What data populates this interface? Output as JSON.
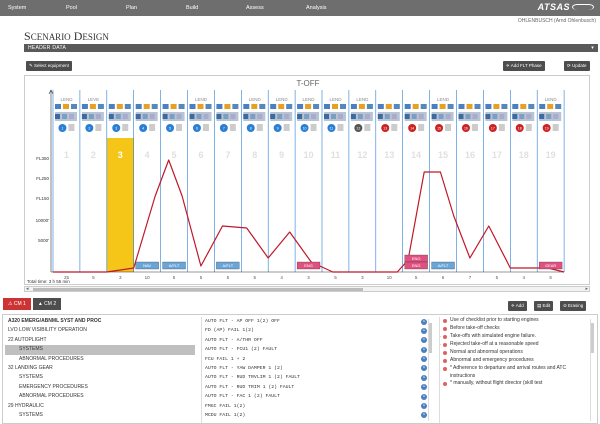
{
  "nav": {
    "menu": [
      "System",
      "Pool",
      "Plan",
      "Build",
      "Assess",
      "Analysis"
    ],
    "logo": "ATSAS"
  },
  "user": "OHLENBUSCH (Arnd Ohlenbusch)",
  "page": {
    "title": "Scenario design",
    "header_bar": "HEADER DATA"
  },
  "toolbar": {
    "select_equipment": "Select equipment",
    "add_flt_phase": "Add FLT Phase",
    "update": "Update"
  },
  "timeline": {
    "title": "T-OFF",
    "phase_labels": [
      "LEND",
      "LEVE",
      "",
      "",
      "",
      "LEND",
      "",
      "LEND",
      "LEND",
      "LEND",
      "LEND",
      "LEND",
      "",
      "",
      "LEND",
      "",
      "",
      "",
      "LEND",
      ""
    ],
    "steps": [
      1,
      2,
      3,
      4,
      5,
      6,
      7,
      8,
      9,
      10,
      11,
      12,
      13,
      14,
      15,
      16,
      17,
      18,
      19
    ],
    "selected_step": 3,
    "y_labels": [
      "FL350",
      "FL250",
      "FL150",
      "10000'",
      "5000'"
    ],
    "bottom_numbers": [
      "25",
      "5",
      "3",
      "10",
      "5",
      "5",
      "5",
      "5",
      "4",
      "3",
      "5",
      "3",
      "10",
      "5",
      "6",
      "7",
      "5",
      "4",
      "5"
    ],
    "bars": [
      {
        "step": 4,
        "label": "NAV"
      },
      {
        "step": 5,
        "label": "A/FLT"
      },
      {
        "step": 7,
        "label": "A/FLT"
      },
      {
        "step": 10,
        "label": "ENG"
      },
      {
        "step": 14,
        "label": "ENG"
      },
      {
        "step": 14,
        "label": "ENG"
      },
      {
        "step": 15,
        "label": "A/FLT"
      },
      {
        "step": 19,
        "label": "GEAR"
      }
    ],
    "total_time": "Total time: 3 h 55 min",
    "icon_colors": [
      "#2a7fd4",
      "#2a7fd4",
      "#2a7fd4",
      "#2a7fd4",
      "#2a7fd4",
      "#2a7fd4",
      "#2a7fd4",
      "#2a7fd4",
      "#2a7fd4",
      "#2a7fd4",
      "#2a7fd4",
      "#555555",
      "#cc2222",
      "#cc2222",
      "#cc2222",
      "#cc2222",
      "#cc2222",
      "#cc2222",
      "#cc2222"
    ],
    "circle_numbers": [
      "1",
      "2",
      "3",
      "4",
      "5",
      "6",
      "7",
      "8",
      "9",
      "10",
      "11",
      "12",
      "13",
      "14",
      "15",
      "16",
      "17",
      "18",
      "19"
    ]
  },
  "bottom": {
    "tabs": [
      "CM 1",
      "CM 2"
    ],
    "buttons": {
      "add": "Add",
      "edit": "Edit",
      "erasing": "Erasing"
    },
    "col_a": [
      {
        "text": "A320 EMERG/ABNML SYST AND PROC",
        "style": "b"
      },
      {
        "text": "LVO LOW VISIBILITY OPERATION",
        "style": ""
      },
      {
        "text": "22 AUTOPLIGHT",
        "style": ""
      },
      {
        "text": "SYSTEMS",
        "style": "ind sel"
      },
      {
        "text": "ABNORMAL PROCEDURES",
        "style": "ind"
      },
      {
        "text": "32 LANDING GEAR",
        "style": ""
      },
      {
        "text": "SYSTEMS",
        "style": "ind"
      },
      {
        "text": "EMERGENCY PROCEDURES",
        "style": "ind"
      },
      {
        "text": "ABNORMAL PROCEDURES",
        "style": "ind"
      },
      {
        "text": "29 HYDRAULIC",
        "style": ""
      },
      {
        "text": "SYSTEMS",
        "style": "ind"
      }
    ],
    "col_b": [
      "AUTO FLT - AP OFF 1(2) OFF",
      "FD (AP) FAIL 1(2)",
      "AUTO FLT - A/THR OFF",
      "AUTO FLT - FCU1 (2) FAULT",
      "FCU FAIL 1 + 2",
      "AUTO FLT - YAW DAMPER 1 (2)",
      "AUTO FLT - RUD TRVLIM 1 (2) FAULT",
      "AUTO FLT - RUD TRIM 1 (2) FAULT",
      "AUTO FLT - FAC 1 (2) FAULT",
      "FMGC FAIL 1(2)",
      "MCDU FAIL 1(2)"
    ],
    "col_c": [
      "Use of checklist prior to starting engines",
      "Before take-off checks",
      "Take-offs with simulated engine failure.",
      "Rejected take-off at a reasonable speed",
      "Normal and abnormal operations",
      "Abnormal and emergency procedures",
      "* Adherence to departure and arrival routes and ATC instructions",
      "* manually, without flight director (skill test"
    ],
    "col_c_nums": [
      "",
      "",
      "1",
      "1",
      "",
      "",
      "",
      ""
    ]
  }
}
